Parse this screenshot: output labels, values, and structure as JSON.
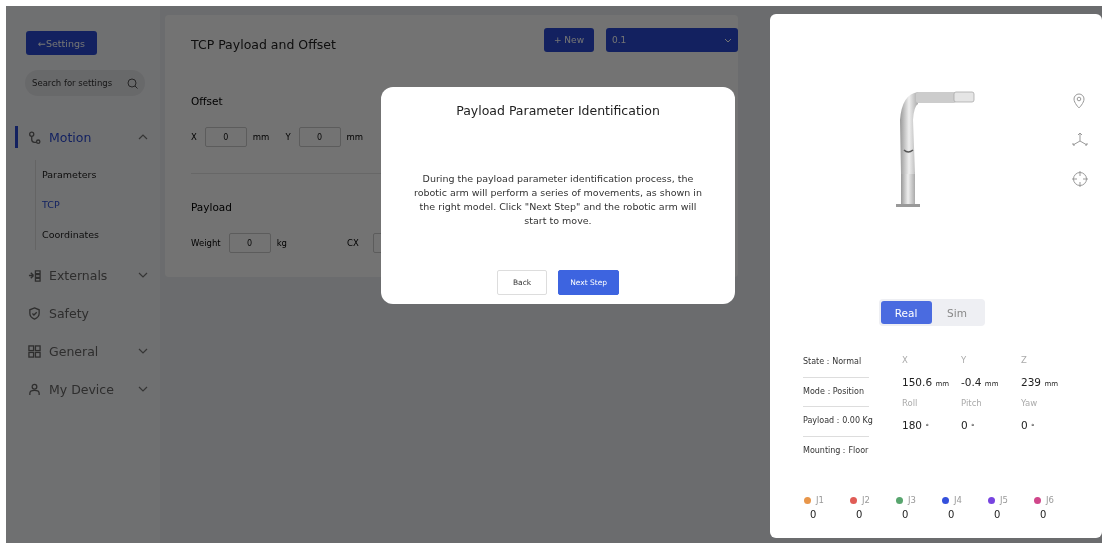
{
  "sidebar": {
    "back_button": "←Settings",
    "search": {
      "placeholder": "Search for settings"
    },
    "items": [
      {
        "label": "Motion",
        "selected": true,
        "expanded": true,
        "children": [
          {
            "label": "Parameters",
            "selected": false
          },
          {
            "label": "TCP",
            "selected": true
          },
          {
            "label": "Coordinates",
            "selected": false
          }
        ]
      },
      {
        "label": "Externals",
        "selected": false,
        "expanded": false
      },
      {
        "label": "Safety",
        "selected": false
      },
      {
        "label": "General",
        "selected": false,
        "expanded": false
      },
      {
        "label": "My Device",
        "selected": false,
        "expanded": false
      }
    ]
  },
  "content": {
    "title": "TCP Payload and Offset",
    "new_button": "+ New",
    "profile_select": {
      "value": "0.1"
    },
    "sections": [
      {
        "title": "Offset",
        "fields": [
          {
            "label": "X",
            "value": "0",
            "unit": "mm"
          },
          {
            "label": "Y",
            "value": "0",
            "unit": "mm"
          }
        ]
      },
      {
        "title": "Payload",
        "fields": [
          {
            "label": "Weight",
            "value": "0",
            "unit": "kg"
          },
          {
            "label": "CX"
          }
        ]
      }
    ]
  },
  "dialog": {
    "title": "Payload Parameter Identification",
    "message": "During the payload parameter identification process, the robotic arm will perform a series of movements, as shown in the right model. Click \"Next Step\" and the robotic arm will start to move.",
    "buttons": [
      {
        "label": "Back",
        "kind": "secondary"
      },
      {
        "label": "Next Step",
        "kind": "primary"
      }
    ]
  },
  "robot_panel": {
    "modes": [
      {
        "label": "Real",
        "selected": true
      },
      {
        "label": "Sim",
        "selected": false
      }
    ],
    "status": [
      "State：Normal",
      "Mode：Position",
      "Payload：0.00 Kg",
      "Mounting：Floor"
    ],
    "pose": [
      {
        "label": "X",
        "value": "150.6",
        "unit": "mm"
      },
      {
        "label": "Y",
        "value": "-0.4",
        "unit": "mm"
      },
      {
        "label": "Z",
        "value": "239",
        "unit": "mm"
      },
      {
        "label": "Roll",
        "value": "180",
        "unit": "°"
      },
      {
        "label": "Pitch",
        "value": "0",
        "unit": "°"
      },
      {
        "label": "Yaw",
        "value": "0",
        "unit": "°"
      }
    ],
    "joints": [
      {
        "label": "J1",
        "color": "#e8964a",
        "value": "0"
      },
      {
        "label": "J2",
        "color": "#e05c56",
        "value": "0"
      },
      {
        "label": "J3",
        "color": "#58a56e",
        "value": "0"
      },
      {
        "label": "J4",
        "color": "#3450dc",
        "value": "0"
      },
      {
        "label": "J5",
        "color": "#7744e0",
        "value": "0"
      },
      {
        "label": "J6",
        "color": "#d0468a",
        "value": "0"
      }
    ]
  }
}
